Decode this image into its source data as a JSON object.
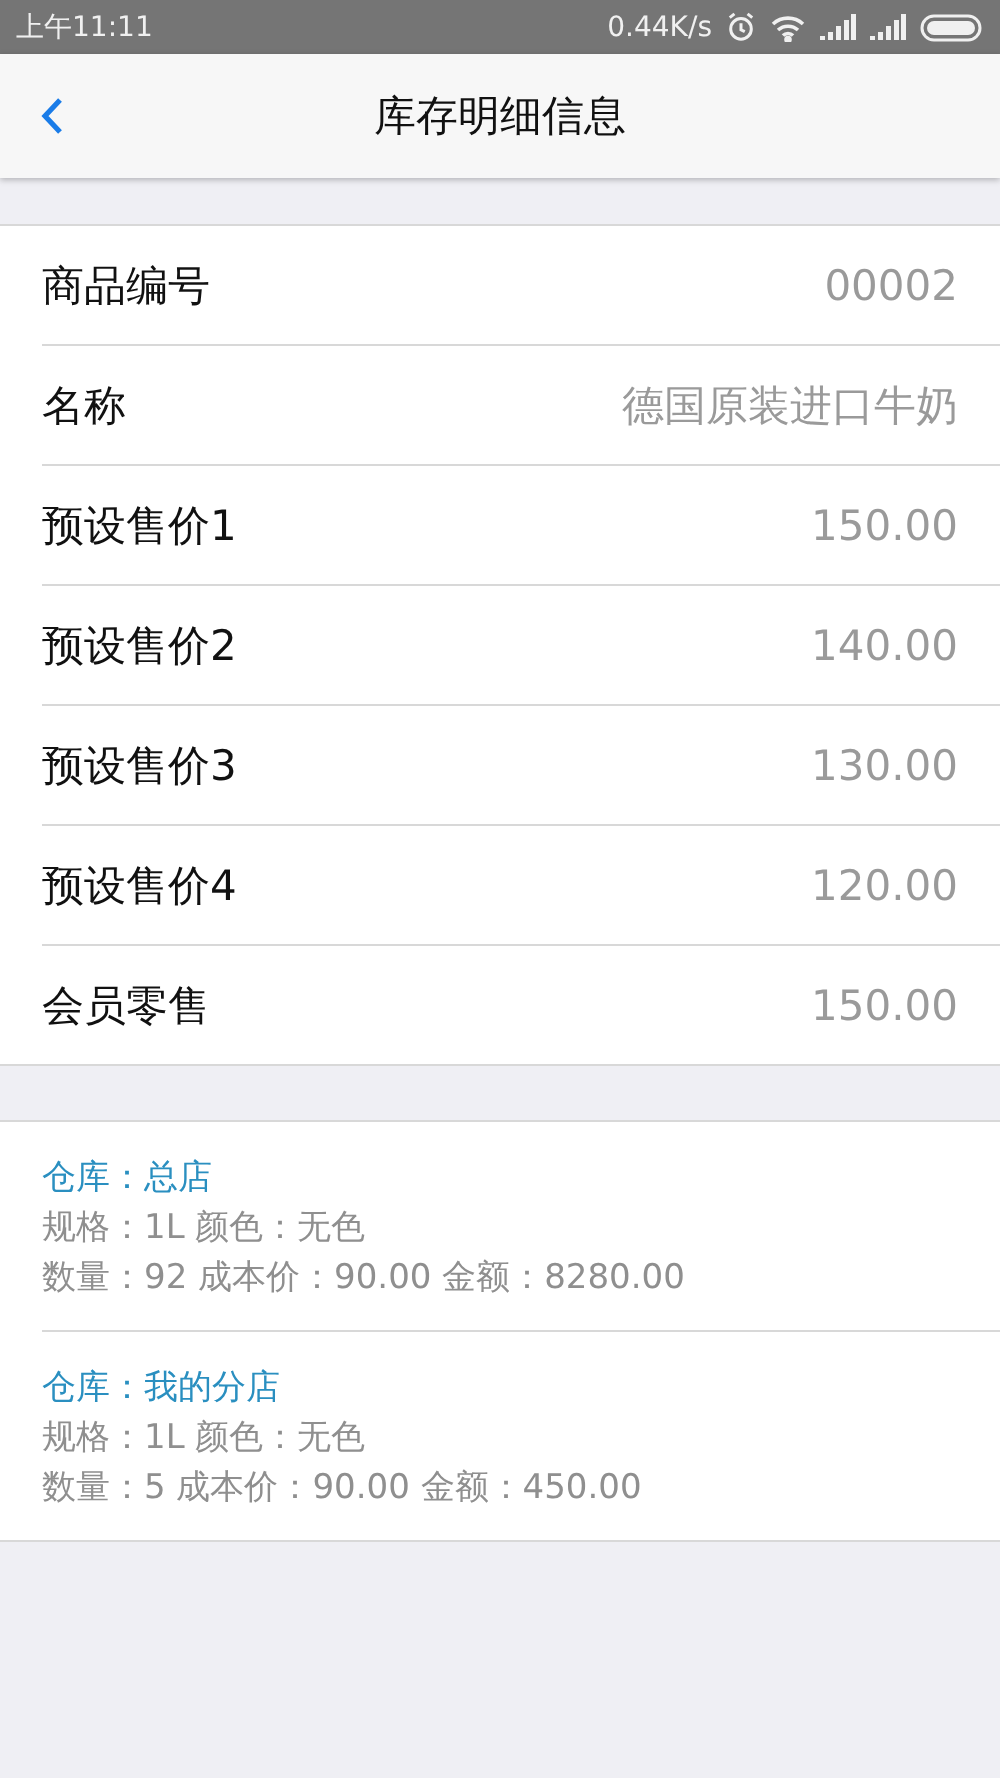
{
  "status_bar": {
    "time": "上午11:11",
    "speed": "0.44K/s"
  },
  "nav": {
    "title": "库存明细信息"
  },
  "fields": [
    {
      "label": "商品编号",
      "value": "00002"
    },
    {
      "label": "名称",
      "value": "德国原装进口牛奶"
    },
    {
      "label": "预设售价1",
      "value": "150.00"
    },
    {
      "label": "预设售价2",
      "value": "140.00"
    },
    {
      "label": "预设售价3",
      "value": "130.00"
    },
    {
      "label": "预设售价4",
      "value": "120.00"
    },
    {
      "label": "会员零售",
      "value": "150.00"
    }
  ],
  "warehouses": [
    {
      "name": "仓库：总店",
      "spec": "规格：1L 颜色：无色",
      "summary": "数量：92 成本价：90.00 金额：8280.00"
    },
    {
      "name": "仓库：我的分店",
      "spec": "规格：1L 颜色：无色",
      "summary": "数量：5 成本价：90.00 金额：450.00"
    }
  ]
}
